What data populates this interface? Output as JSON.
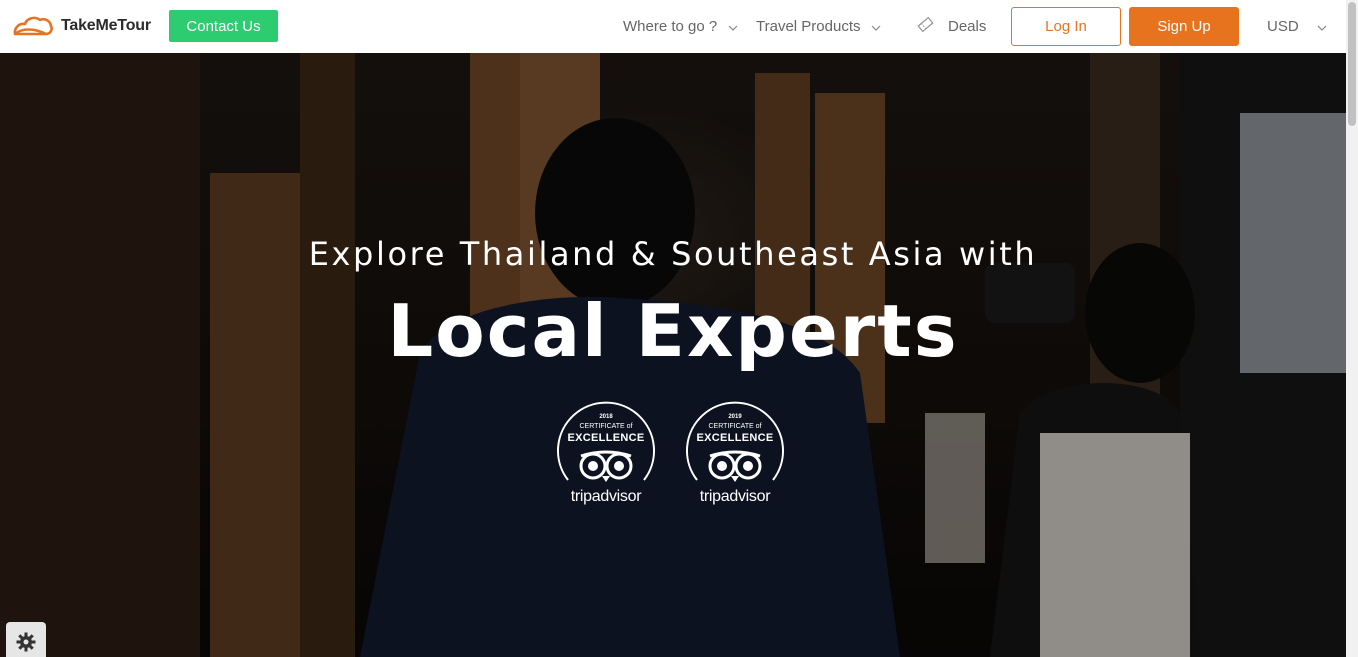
{
  "header": {
    "brand": "TakeMeTour",
    "contact_label": "Contact Us",
    "nav": {
      "where_label": "Where to go ?",
      "products_label": "Travel Products",
      "deals_label": "Deals"
    },
    "login_label": "Log In",
    "signup_label": "Sign Up",
    "currency": "USD"
  },
  "hero": {
    "subtitle": "Explore Thailand & Southeast Asia with",
    "title": "Local Experts",
    "badges": [
      {
        "year": "2018",
        "cert": "CERTIFICATE of",
        "excellence": "EXCELLENCE",
        "brand": "tripadvisor"
      },
      {
        "year": "2019",
        "cert": "CERTIFICATE of",
        "excellence": "EXCELLENCE",
        "brand": "tripadvisor"
      }
    ]
  },
  "colors": {
    "brand_orange": "#e8731f",
    "contact_green": "#2ecc71",
    "nav_text": "#666666"
  },
  "icons": [
    "logo-cloud-icon",
    "chevron-down-icon",
    "ticket-icon",
    "owl-eyes-icon",
    "gear-icon"
  ]
}
